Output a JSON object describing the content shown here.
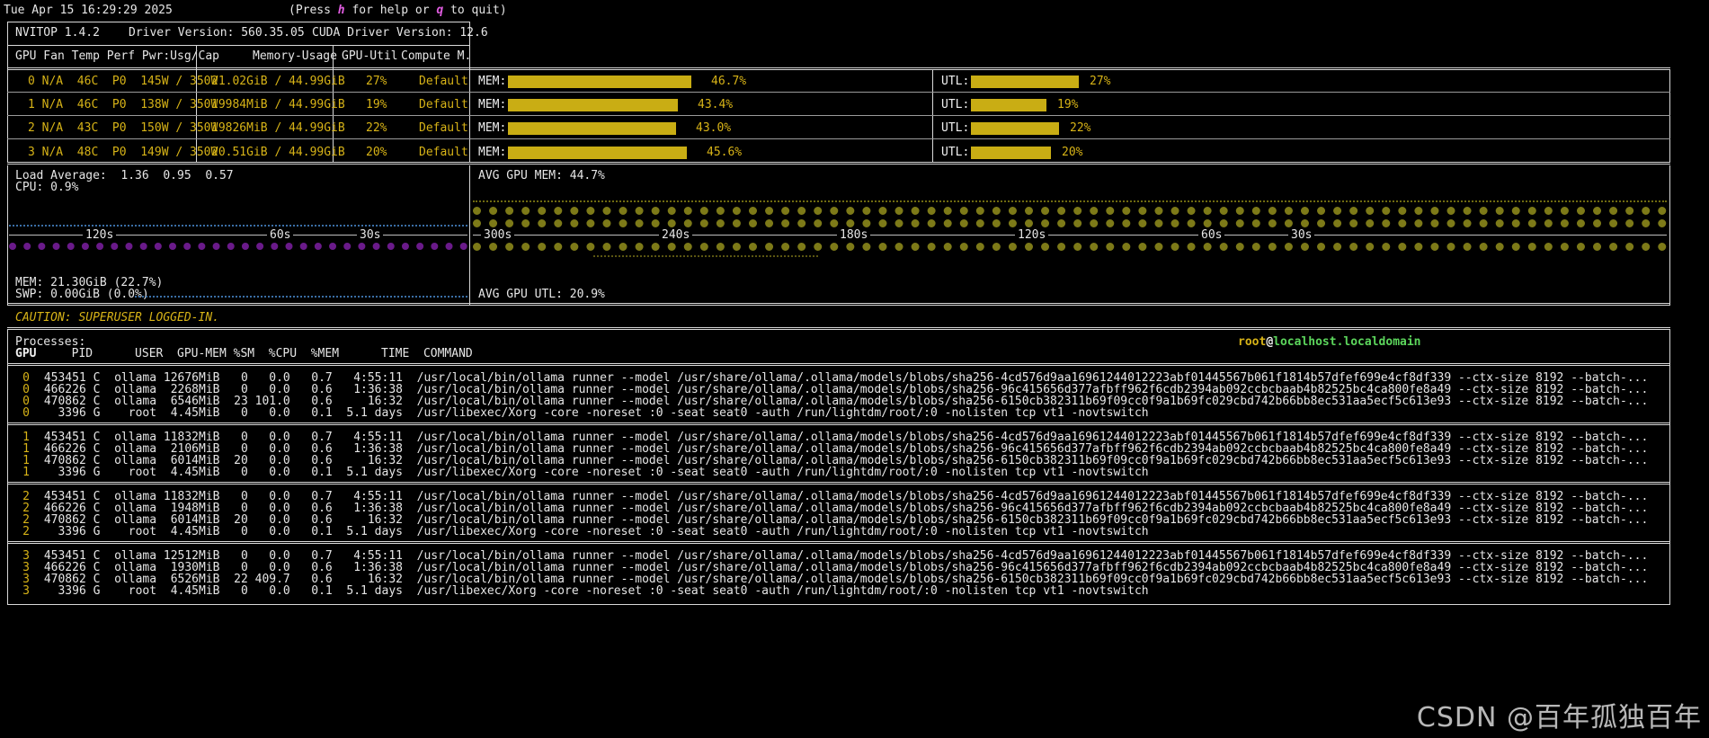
{
  "header": {
    "datetime": "Tue Apr 15 16:29:29 2025",
    "help_prefix": "(Press ",
    "help_key_h": "h",
    "help_mid": " for help or ",
    "help_key_q": "q",
    "help_suffix": " to quit)"
  },
  "driver": {
    "nvitop": "NVITOP 1.4.2",
    "driver_version": "Driver Version: 560.35.05",
    "cuda_version": "CUDA Driver Version: 12.6"
  },
  "gpu_table_headers": {
    "left": "GPU Fan Temp Perf Pwr:Usg/Cap",
    "memory": "Memory-Usage",
    "util": "GPU-Util",
    "compute": "Compute M."
  },
  "gpus": [
    {
      "left": "0 N/A  46C  P0  145W / 350W",
      "memory": "21.02GiB / 44.99GiB",
      "util": "27%",
      "compute": "Default",
      "mem_label": "MEM:",
      "mem_pct": "46.7%",
      "mem_frac": 0.467,
      "utl_label": "UTL:",
      "utl_pct": "27%",
      "utl_frac": 0.27
    },
    {
      "left": "1 N/A  46C  P0  138W / 350W",
      "memory": "19984MiB / 44.99GiB",
      "util": "19%",
      "compute": "Default",
      "mem_label": "MEM:",
      "mem_pct": "43.4%",
      "mem_frac": 0.434,
      "utl_label": "UTL:",
      "utl_pct": "19%",
      "utl_frac": 0.19
    },
    {
      "left": "2 N/A  43C  P0  150W / 350W",
      "memory": "19826MiB / 44.99GiB",
      "util": "22%",
      "compute": "Default",
      "mem_label": "MEM:",
      "mem_pct": "43.0%",
      "mem_frac": 0.43,
      "utl_label": "UTL:",
      "utl_pct": "22%",
      "utl_frac": 0.22
    },
    {
      "left": "3 N/A  48C  P0  149W / 350W",
      "memory": "20.51GiB / 44.99GiB",
      "util": "20%",
      "compute": "Default",
      "mem_label": "MEM:",
      "mem_pct": "45.6%",
      "mem_frac": 0.456,
      "utl_label": "UTL:",
      "utl_pct": "20%",
      "utl_frac": 0.2
    }
  ],
  "host_panel": {
    "load_average": "Load Average:  1.36  0.95  0.57",
    "cpu": "CPU: 0.9%",
    "mem": "MEM: 21.30GiB (22.7%)",
    "swp": "SWP: 0.00GiB (0.0%)",
    "ticks": [
      "120s",
      "60s",
      "30s"
    ]
  },
  "gpu_history_panel": {
    "avg_mem": "AVG GPU MEM: 44.7%",
    "avg_utl": "AVG GPU UTL: 20.9%",
    "ticks": [
      "300s",
      "240s",
      "180s",
      "120s",
      "60s",
      "30s"
    ]
  },
  "caution": "CAUTION: SUPERUSER LOGGED-IN.",
  "processes": {
    "title": "Processes:",
    "user": "root",
    "at": "@",
    "host": "localhost.localdomain",
    "headers": {
      "gpu": "GPU",
      "rest": "     PID      USER  GPU-MEM %SM  %CPU  %MEM      TIME  COMMAND"
    },
    "groups": [
      [
        {
          "gpu": "0",
          "rest": " 453451 C  ollama 12676MiB   0   0.0   0.7   4:55:11  /usr/local/bin/ollama runner --model /usr/share/ollama/.ollama/models/blobs/sha256-4cd576d9aa16961244012223abf01445567b061f1814b57dfef699e4cf8df339 --ctx-size 8192 --batch-..."
        },
        {
          "gpu": "0",
          "rest": " 466226 C  ollama  2268MiB   0   0.0   0.6   1:36:38  /usr/local/bin/ollama runner --model /usr/share/ollama/.ollama/models/blobs/sha256-96c415656d377afbff962f6cdb2394ab092ccbcbaab4b82525bc4ca800fe8a49 --ctx-size 8192 --batch-..."
        },
        {
          "gpu": "0",
          "rest": " 470862 C  ollama  6546MiB  23 101.0   0.6     16:32  /usr/local/bin/ollama runner --model /usr/share/ollama/.ollama/models/blobs/sha256-6150cb382311b69f09cc0f9a1b69fc029cbd742b66bb8ec531aa5ecf5c613e93 --ctx-size 8192 --batch-..."
        },
        {
          "gpu": "0",
          "rest": "   3396 G    root  4.45MiB   0   0.0   0.1  5.1 days  /usr/libexec/Xorg -core -noreset :0 -seat seat0 -auth /run/lightdm/root/:0 -nolisten tcp vt1 -novtswitch"
        }
      ],
      [
        {
          "gpu": "1",
          "rest": " 453451 C  ollama 11832MiB   0   0.0   0.7   4:55:11  /usr/local/bin/ollama runner --model /usr/share/ollama/.ollama/models/blobs/sha256-4cd576d9aa16961244012223abf01445567b061f1814b57dfef699e4cf8df339 --ctx-size 8192 --batch-..."
        },
        {
          "gpu": "1",
          "rest": " 466226 C  ollama  2106MiB   0   0.0   0.6   1:36:38  /usr/local/bin/ollama runner --model /usr/share/ollama/.ollama/models/blobs/sha256-96c415656d377afbff962f6cdb2394ab092ccbcbaab4b82525bc4ca800fe8a49 --ctx-size 8192 --batch-..."
        },
        {
          "gpu": "1",
          "rest": " 470862 C  ollama  6014MiB  20   0.0   0.6     16:32  /usr/local/bin/ollama runner --model /usr/share/ollama/.ollama/models/blobs/sha256-6150cb382311b69f09cc0f9a1b69fc029cbd742b66bb8ec531aa5ecf5c613e93 --ctx-size 8192 --batch-..."
        },
        {
          "gpu": "1",
          "rest": "   3396 G    root  4.45MiB   0   0.0   0.1  5.1 days  /usr/libexec/Xorg -core -noreset :0 -seat seat0 -auth /run/lightdm/root/:0 -nolisten tcp vt1 -novtswitch"
        }
      ],
      [
        {
          "gpu": "2",
          "rest": " 453451 C  ollama 11832MiB   0   0.0   0.7   4:55:11  /usr/local/bin/ollama runner --model /usr/share/ollama/.ollama/models/blobs/sha256-4cd576d9aa16961244012223abf01445567b061f1814b57dfef699e4cf8df339 --ctx-size 8192 --batch-..."
        },
        {
          "gpu": "2",
          "rest": " 466226 C  ollama  1948MiB   0   0.0   0.6   1:36:38  /usr/local/bin/ollama runner --model /usr/share/ollama/.ollama/models/blobs/sha256-96c415656d377afbff962f6cdb2394ab092ccbcbaab4b82525bc4ca800fe8a49 --ctx-size 8192 --batch-..."
        },
        {
          "gpu": "2",
          "rest": " 470862 C  ollama  6014MiB  20   0.0   0.6     16:32  /usr/local/bin/ollama runner --model /usr/share/ollama/.ollama/models/blobs/sha256-6150cb382311b69f09cc0f9a1b69fc029cbd742b66bb8ec531aa5ecf5c613e93 --ctx-size 8192 --batch-..."
        },
        {
          "gpu": "2",
          "rest": "   3396 G    root  4.45MiB   0   0.0   0.1  5.1 days  /usr/libexec/Xorg -core -noreset :0 -seat seat0 -auth /run/lightdm/root/:0 -nolisten tcp vt1 -novtswitch"
        }
      ],
      [
        {
          "gpu": "3",
          "rest": " 453451 C  ollama 12512MiB   0   0.0   0.7   4:55:11  /usr/local/bin/ollama runner --model /usr/share/ollama/.ollama/models/blobs/sha256-4cd576d9aa16961244012223abf01445567b061f1814b57dfef699e4cf8df339 --ctx-size 8192 --batch-..."
        },
        {
          "gpu": "3",
          "rest": " 466226 C  ollama  1930MiB   0   0.0   0.6   1:36:38  /usr/local/bin/ollama runner --model /usr/share/ollama/.ollama/models/blobs/sha256-96c415656d377afbff962f6cdb2394ab092ccbcbaab4b82525bc4ca800fe8a49 --ctx-size 8192 --batch-..."
        },
        {
          "gpu": "3",
          "rest": " 470862 C  ollama  6526MiB  22 409.7   0.6     16:32  /usr/local/bin/ollama runner --model /usr/share/ollama/.ollama/models/blobs/sha256-6150cb382311b69f09cc0f9a1b69fc029cbd742b66bb8ec531aa5ecf5c613e93 --ctx-size 8192 --batch-..."
        },
        {
          "gpu": "3",
          "rest": "   3396 G    root  4.45MiB   0   0.0   0.1  5.1 days  /usr/libexec/Xorg -core -noreset :0 -seat seat0 -auth /run/lightdm/root/:0 -nolisten tcp vt1 -novtswitch"
        }
      ]
    ]
  },
  "watermark": "CSDN @百年孤独百年",
  "colors": {
    "gold": "#d7b317",
    "bar": "#c9ad14",
    "green": "#4fc24f",
    "magenta": "#e05ce0"
  }
}
